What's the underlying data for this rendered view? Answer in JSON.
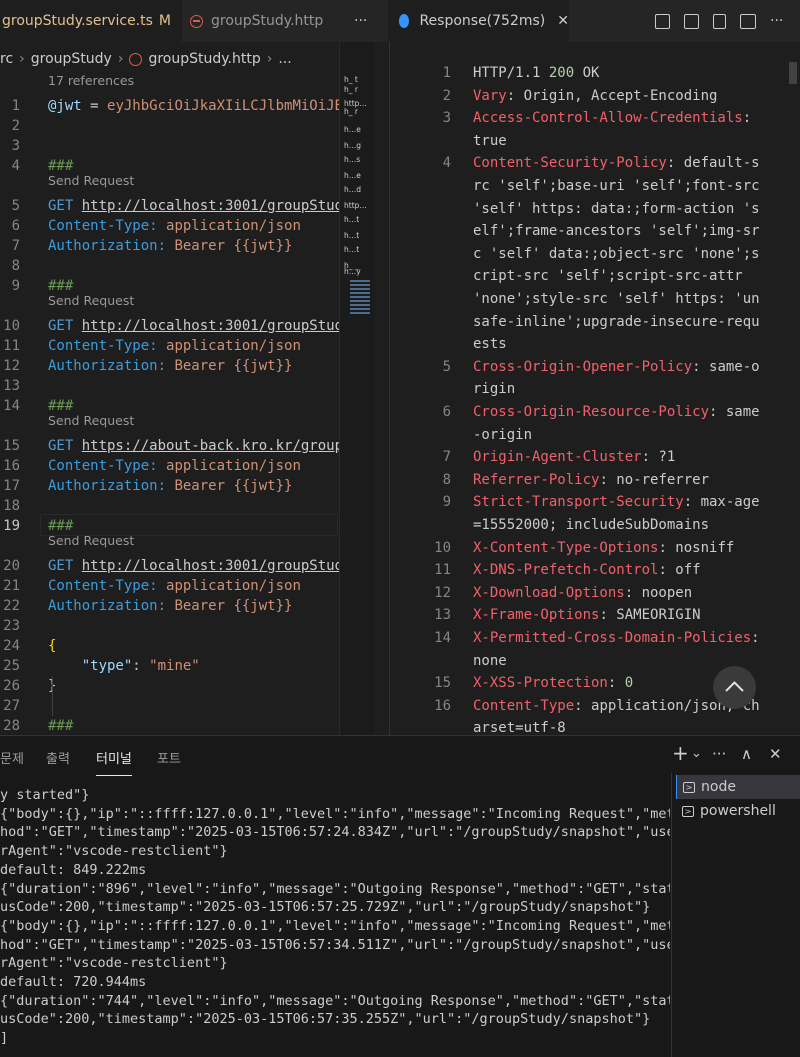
{
  "tabs_left": [
    {
      "label": "groupStudy.service.ts",
      "modified": "M"
    },
    {
      "label": "groupStudy.http"
    }
  ],
  "tabs_right": [
    {
      "label": "Response(752ms)"
    }
  ],
  "tab_overflow": "···",
  "breadcrumb": [
    "rc",
    "groupStudy",
    "groupStudy.http",
    "..."
  ],
  "left_editor": {
    "references": "17 references",
    "send_request": "Send Request",
    "lines": [
      {
        "n": "1",
        "parts": [
          [
            "var",
            "@jwt"
          ],
          [
            "plain",
            " = "
          ],
          [
            "str",
            "eyJhbGciOiJkaXIiLCJlbmMiOiJB"
          ]
        ]
      },
      {
        "n": "2",
        "parts": []
      },
      {
        "n": "3",
        "parts": []
      },
      {
        "n": "4",
        "parts": [
          [
            "cmt",
            "###"
          ]
        ]
      },
      {
        "n": "5",
        "parts": [
          [
            "meth",
            "GET "
          ],
          [
            "url",
            "http://localhost:3001/groupStud"
          ]
        ]
      },
      {
        "n": "6",
        "parts": [
          [
            "hkey",
            "Content-Type"
          ],
          [
            "hkey",
            ": "
          ],
          [
            "hval",
            "application/json"
          ]
        ]
      },
      {
        "n": "7",
        "parts": [
          [
            "hkey",
            "Authorization"
          ],
          [
            "hkey",
            ": "
          ],
          [
            "hval",
            "Bearer {{jwt}}"
          ]
        ]
      },
      {
        "n": "8",
        "parts": []
      },
      {
        "n": "9",
        "parts": [
          [
            "cmt",
            "###"
          ]
        ]
      },
      {
        "n": "10",
        "parts": [
          [
            "meth",
            "GET "
          ],
          [
            "url",
            "http://localhost:3001/groupStud"
          ]
        ]
      },
      {
        "n": "11",
        "parts": [
          [
            "hkey",
            "Content-Type"
          ],
          [
            "hkey",
            ": "
          ],
          [
            "hval",
            "application/json"
          ]
        ]
      },
      {
        "n": "12",
        "parts": [
          [
            "hkey",
            "Authorization"
          ],
          [
            "hkey",
            ": "
          ],
          [
            "hval",
            "Bearer {{jwt}}"
          ]
        ]
      },
      {
        "n": "13",
        "parts": []
      },
      {
        "n": "14",
        "parts": [
          [
            "cmt",
            "###"
          ]
        ]
      },
      {
        "n": "15",
        "parts": [
          [
            "meth",
            "GET "
          ],
          [
            "url",
            "https://about-back.kro.kr/group"
          ]
        ]
      },
      {
        "n": "16",
        "parts": [
          [
            "hkey",
            "Content-Type"
          ],
          [
            "hkey",
            ": "
          ],
          [
            "hval",
            "application/json"
          ]
        ]
      },
      {
        "n": "17",
        "parts": [
          [
            "hkey",
            "Authorization"
          ],
          [
            "hkey",
            ": "
          ],
          [
            "hval",
            "Bearer {{jwt}}"
          ]
        ]
      },
      {
        "n": "18",
        "parts": []
      },
      {
        "n": "19",
        "parts": [
          [
            "cmt",
            "###"
          ]
        ],
        "current": true
      },
      {
        "n": "20",
        "parts": [
          [
            "meth",
            "GET "
          ],
          [
            "url",
            "http://localhost:3001/groupStud"
          ]
        ]
      },
      {
        "n": "21",
        "parts": [
          [
            "hkey",
            "Content-Type"
          ],
          [
            "hkey",
            ": "
          ],
          [
            "hval",
            "application/json"
          ]
        ]
      },
      {
        "n": "22",
        "parts": [
          [
            "hkey",
            "Authorization"
          ],
          [
            "hkey",
            ": "
          ],
          [
            "hval",
            "Bearer {{jwt}}"
          ]
        ]
      },
      {
        "n": "23",
        "parts": []
      },
      {
        "n": "24",
        "parts": [
          [
            "brace",
            "{"
          ]
        ]
      },
      {
        "n": "25",
        "parts": [
          [
            "plain",
            "    "
          ],
          [
            "prop",
            "\"type\""
          ],
          [
            "plain",
            ": "
          ],
          [
            "str",
            "\"mine\""
          ]
        ]
      },
      {
        "n": "26",
        "parts": [
          [
            "brace",
            "}"
          ]
        ]
      },
      {
        "n": "27",
        "parts": []
      },
      {
        "n": "28",
        "parts": [
          [
            "cmt",
            "###"
          ]
        ]
      }
    ],
    "minimap_labels": [
      "h_ t",
      "h_ r",
      "http…",
      "h_ r",
      "h…e",
      "h…g",
      "h…s",
      "h…e",
      "h…d",
      "http…",
      "h…t",
      "h…t",
      "h…t",
      "h_ _",
      "h…y"
    ]
  },
  "response": {
    "lines": [
      {
        "n": "1",
        "segs": [
          [
            "plain",
            "HTTP/1.1 "
          ],
          [
            "num",
            "200"
          ],
          [
            "plain",
            " OK"
          ]
        ]
      },
      {
        "n": "2",
        "segs": [
          [
            "key",
            "Vary"
          ],
          [
            "plain",
            ": Origin, Accept-Encoding"
          ]
        ]
      },
      {
        "n": "3",
        "segs": [
          [
            "key",
            "Access-Control-Allow-Credentials"
          ],
          [
            "plain",
            ":"
          ]
        ]
      },
      {
        "n": "",
        "segs": [
          [
            "plain",
            "true"
          ]
        ]
      },
      {
        "n": "4",
        "segs": [
          [
            "key",
            "Content-Security-Policy"
          ],
          [
            "plain",
            ": default-s"
          ]
        ]
      },
      {
        "n": "",
        "segs": [
          [
            "plain",
            "rc 'self';base-uri 'self';font-src"
          ]
        ]
      },
      {
        "n": "",
        "segs": [
          [
            "plain",
            "'self' https: data:;form-action 's"
          ]
        ]
      },
      {
        "n": "",
        "segs": [
          [
            "plain",
            "elf';frame-ancestors 'self';img-sr"
          ]
        ]
      },
      {
        "n": "",
        "segs": [
          [
            "plain",
            "c 'self' data:;object-src 'none';s"
          ]
        ]
      },
      {
        "n": "",
        "segs": [
          [
            "plain",
            "cript-src 'self';script-src-attr"
          ]
        ]
      },
      {
        "n": "",
        "segs": [
          [
            "plain",
            "'none';style-src 'self' https: 'un"
          ]
        ]
      },
      {
        "n": "",
        "segs": [
          [
            "plain",
            "safe-inline';upgrade-insecure-requ"
          ]
        ]
      },
      {
        "n": "",
        "segs": [
          [
            "plain",
            "ests"
          ]
        ]
      },
      {
        "n": "5",
        "segs": [
          [
            "key",
            "Cross-Origin-Opener-Policy"
          ],
          [
            "plain",
            ": same-o"
          ]
        ]
      },
      {
        "n": "",
        "segs": [
          [
            "plain",
            "rigin"
          ]
        ]
      },
      {
        "n": "6",
        "segs": [
          [
            "key",
            "Cross-Origin-Resource-Policy"
          ],
          [
            "plain",
            ": same"
          ]
        ]
      },
      {
        "n": "",
        "segs": [
          [
            "plain",
            "-origin"
          ]
        ]
      },
      {
        "n": "7",
        "segs": [
          [
            "key",
            "Origin-Agent-Cluster"
          ],
          [
            "plain",
            ": ?1"
          ]
        ]
      },
      {
        "n": "8",
        "segs": [
          [
            "key",
            "Referrer-Policy"
          ],
          [
            "plain",
            ": no-referrer"
          ]
        ]
      },
      {
        "n": "9",
        "segs": [
          [
            "key",
            "Strict-Transport-Security"
          ],
          [
            "plain",
            ": max-age"
          ]
        ]
      },
      {
        "n": "",
        "segs": [
          [
            "plain",
            "=15552000; includeSubDomains"
          ]
        ]
      },
      {
        "n": "10",
        "segs": [
          [
            "key",
            "X-Content-Type-Options"
          ],
          [
            "plain",
            ": nosniff"
          ]
        ]
      },
      {
        "n": "11",
        "segs": [
          [
            "key",
            "X-DNS-Prefetch-Control"
          ],
          [
            "plain",
            ": off"
          ]
        ]
      },
      {
        "n": "12",
        "segs": [
          [
            "key",
            "X-Download-Options"
          ],
          [
            "plain",
            ": noopen"
          ]
        ]
      },
      {
        "n": "13",
        "segs": [
          [
            "key",
            "X-Frame-Options"
          ],
          [
            "plain",
            ": SAMEORIGIN"
          ]
        ]
      },
      {
        "n": "14",
        "segs": [
          [
            "key",
            "X-Permitted-Cross-Domain-Policies"
          ],
          [
            "plain",
            ":"
          ]
        ]
      },
      {
        "n": "",
        "segs": [
          [
            "plain",
            "none"
          ]
        ]
      },
      {
        "n": "15",
        "segs": [
          [
            "key",
            "X-XSS-Protection"
          ],
          [
            "plain",
            ": "
          ],
          [
            "num",
            "0"
          ]
        ]
      },
      {
        "n": "16",
        "segs": [
          [
            "key",
            "Content-Type"
          ],
          [
            "plain",
            ": application/json; ch"
          ]
        ]
      },
      {
        "n": "",
        "segs": [
          [
            "plain",
            "arset=utf-8"
          ]
        ]
      }
    ]
  },
  "panel": {
    "tabs": [
      "문제",
      "출력",
      "터미널",
      "포트"
    ],
    "active_tab": "터미널",
    "actions": [
      "+",
      "⌄",
      "···",
      "∧",
      "✕"
    ],
    "terminal_lines": [
      "y started\"}",
      "{\"body\":{},\"ip\":\"::ffff:127.0.0.1\",\"level\":\"info\",\"message\":\"Incoming Request\",\"met",
      "hod\":\"GET\",\"timestamp\":\"2025-03-15T06:57:24.834Z\",\"url\":\"/groupStudy/snapshot\",\"use",
      "rAgent\":\"vscode-restclient\"}",
      "default: 849.222ms",
      "{\"duration\":\"896\",\"level\":\"info\",\"message\":\"Outgoing Response\",\"method\":\"GET\",\"stat",
      "usCode\":200,\"timestamp\":\"2025-03-15T06:57:25.729Z\",\"url\":\"/groupStudy/snapshot\"}",
      "{\"body\":{},\"ip\":\"::ffff:127.0.0.1\",\"level\":\"info\",\"message\":\"Incoming Request\",\"met",
      "hod\":\"GET\",\"timestamp\":\"2025-03-15T06:57:34.511Z\",\"url\":\"/groupStudy/snapshot\",\"use",
      "rAgent\":\"vscode-restclient\"}",
      "default: 720.944ms",
      "{\"duration\":\"744\",\"level\":\"info\",\"message\":\"Outgoing Response\",\"method\":\"GET\",\"stat",
      "usCode\":200,\"timestamp\":\"2025-03-15T06:57:35.255Z\",\"url\":\"/groupStudy/snapshot\"}",
      "]"
    ],
    "terminals": [
      {
        "label": "node",
        "selected": true
      },
      {
        "label": "powershell",
        "selected": false
      }
    ]
  },
  "colors": {
    "accent_blue": "#3794ff",
    "header_key": "#f0616b",
    "string": "#ce9178"
  }
}
